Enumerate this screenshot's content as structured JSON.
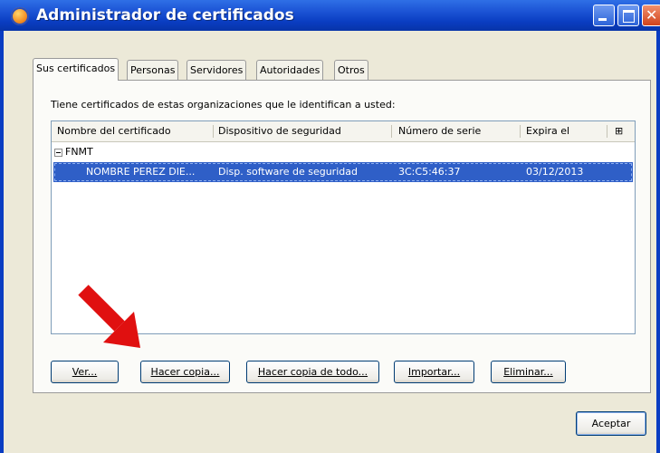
{
  "window": {
    "title": "Administrador de certificados",
    "accent_color": "#0a3dc2"
  },
  "tabs": [
    {
      "label": "Sus certificados",
      "active": true
    },
    {
      "label": "Personas"
    },
    {
      "label": "Servidores"
    },
    {
      "label": "Autoridades"
    },
    {
      "label": "Otros"
    }
  ],
  "panel": {
    "intro_text": "Tiene certificados de estas organizaciones que le identifican a usted:"
  },
  "table": {
    "columns": [
      "Nombre del certificado",
      "Dispositivo de seguridad",
      "Número de serie",
      "Expira el",
      "⊞"
    ],
    "group": "FNMT",
    "rows": [
      {
        "name": "NOMBRE PEREZ DIE...",
        "device": "Disp. software de seguridad",
        "serial": "3C:C5:46:37",
        "expires": "03/12/2013",
        "selected": true
      }
    ]
  },
  "buttons": {
    "ver": "Ver...",
    "hacer_copia": "Hacer copia...",
    "hacer_copia_todo": "Hacer copia de todo...",
    "importar": "Importar...",
    "eliminar": "Eliminar...",
    "aceptar": "Aceptar"
  },
  "annotation": {
    "arrow_color": "#e01010",
    "points_to": "hacer_copia"
  },
  "icons": {
    "app": "firefox-icon",
    "minimize": "minimize-icon",
    "maximize": "maximize-icon",
    "close": "close-icon",
    "column_picker": "column-picker-icon"
  }
}
